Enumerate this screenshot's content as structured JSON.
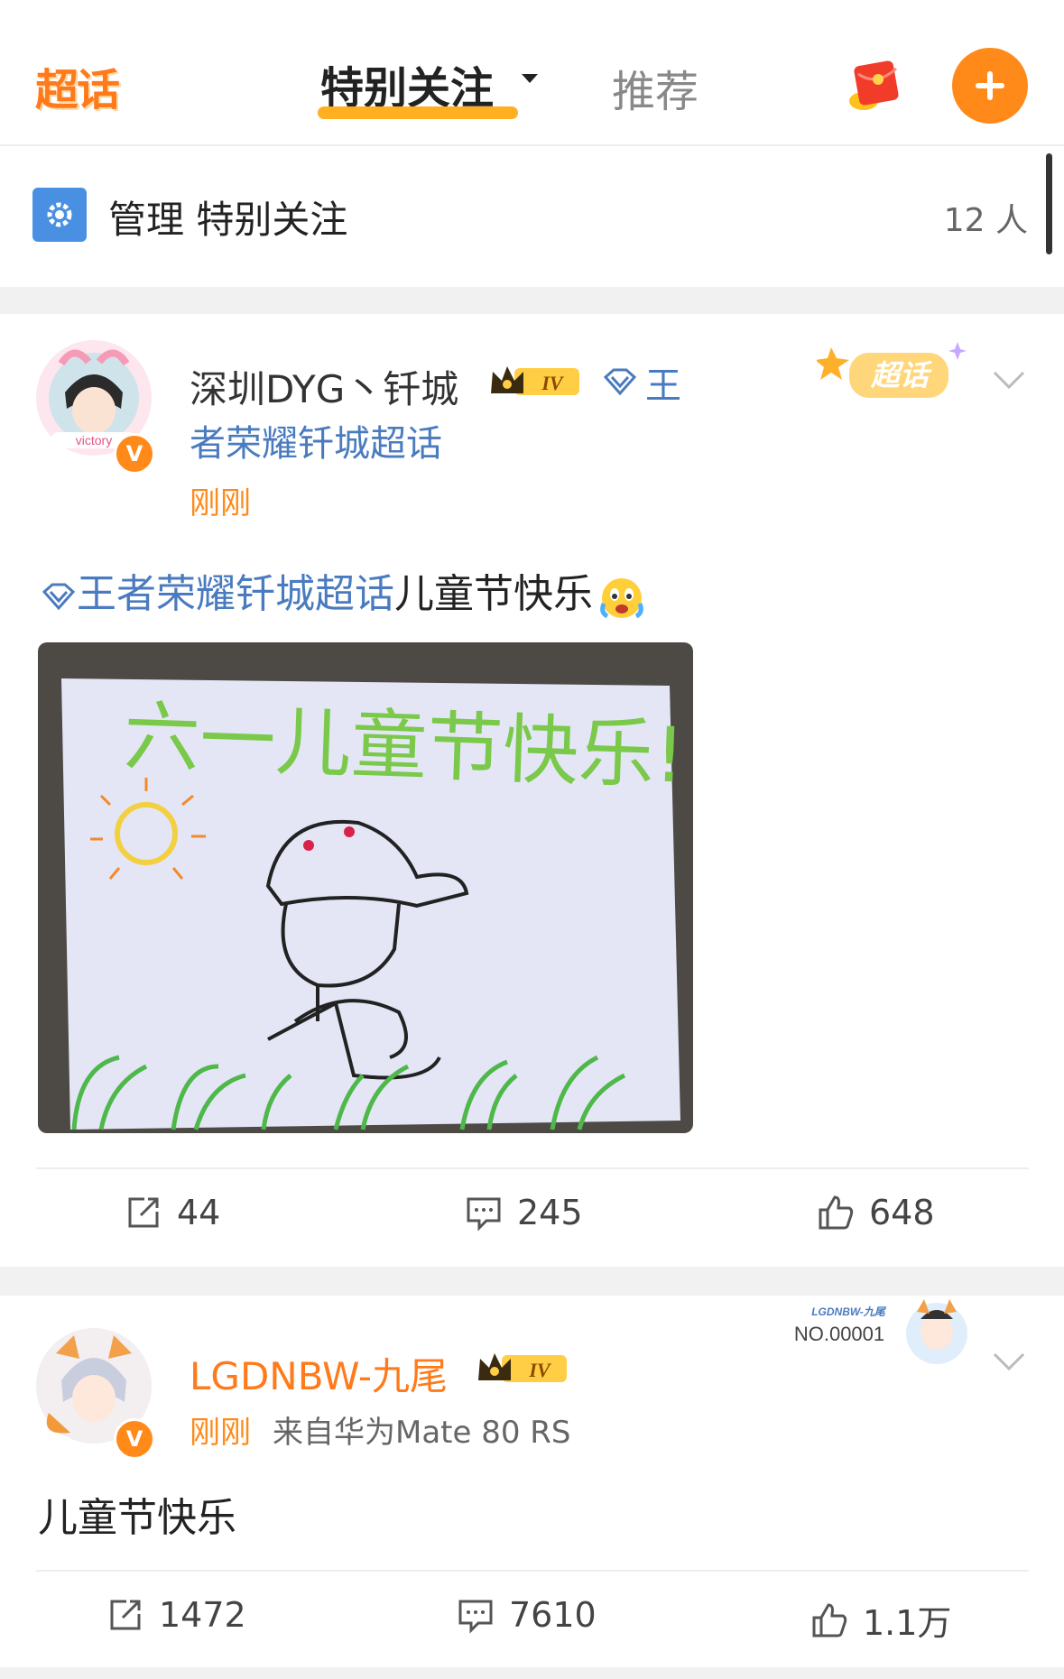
{
  "nav": {
    "logo": "超话",
    "tab_active": "特别关注",
    "tab_inactive": "推荐"
  },
  "manage": {
    "label": "管理  特别关注",
    "count": "12 人"
  },
  "post1": {
    "username": "深圳DYG丶钎城",
    "level": "IV",
    "topic_inline": "王者荣耀钎城超话",
    "time": "刚刚",
    "sticker": "超话",
    "body_link": "王者荣耀钎城超话",
    "body_text": "儿童节快乐",
    "image_caption": "六一儿童节快乐!",
    "avatar_text": "victory",
    "share": "44",
    "comment": "245",
    "like": "648"
  },
  "post2": {
    "username": "LGDNBW-九尾",
    "level": "IV",
    "time": "刚刚",
    "source": "来自华为Mate 80 RS",
    "fan_badge_name": "LGDNBW-九尾",
    "fan_badge_no": "NO.00001",
    "body_text": "儿童节快乐",
    "share": "1472",
    "comment": "7610",
    "like": "1.1万"
  },
  "colors": {
    "accent": "#ff8a1a",
    "link": "#4a7bbf",
    "underline": "#ffb020"
  }
}
